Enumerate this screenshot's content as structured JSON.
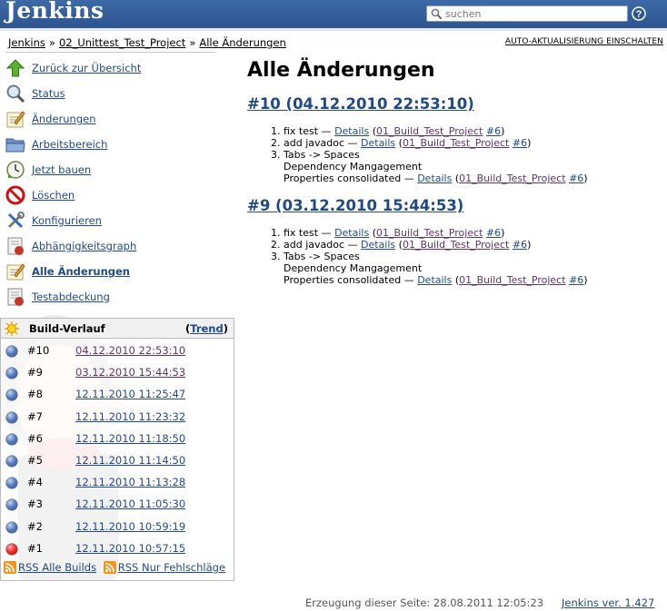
{
  "header": {
    "logo": "Jenkins",
    "search_placeholder": "suchen"
  },
  "breadcrumbs": [
    "Jenkins",
    "02_Unittest_Test_Project",
    "Alle Änderungen"
  ],
  "breadcrumb_separator": "»",
  "autorefresh": "AUTO-AKTUALISIERUNG EINSCHALTEN",
  "tasks": [
    {
      "label": "Zurück zur Übersicht",
      "icon": "up-arrow-icon"
    },
    {
      "label": "Status",
      "icon": "magnifier-icon"
    },
    {
      "label": "Änderungen",
      "icon": "notepad-icon"
    },
    {
      "label": "Arbeitsbereich",
      "icon": "folder-icon"
    },
    {
      "label": "Jetzt bauen",
      "icon": "clock-build-icon"
    },
    {
      "label": "Löschen",
      "icon": "no-entry-icon"
    },
    {
      "label": "Konfigurieren",
      "icon": "tools-icon"
    },
    {
      "label": "Abhängigkeitsgraph",
      "icon": "graph-icon"
    },
    {
      "label": "Alle Änderungen",
      "icon": "notepad-icon"
    },
    {
      "label": "Testabdeckung",
      "icon": "report-icon"
    }
  ],
  "build_history": {
    "title": "Build-Verlauf",
    "trend_label": "Trend",
    "builds": [
      {
        "number": "#10",
        "date": "04.12.2010 22:53:10",
        "status": "blue"
      },
      {
        "number": "#9",
        "date": "03.12.2010 15:44:53",
        "status": "blue"
      },
      {
        "number": "#8",
        "date": "12.11.2010 11:25:47",
        "status": "blue"
      },
      {
        "number": "#7",
        "date": "12.11.2010 11:23:32",
        "status": "blue"
      },
      {
        "number": "#6",
        "date": "12.11.2010 11:18:50",
        "status": "blue"
      },
      {
        "number": "#5",
        "date": "12.11.2010 11:14:50",
        "status": "blue"
      },
      {
        "number": "#4",
        "date": "12.11.2010 11:13:28",
        "status": "blue"
      },
      {
        "number": "#3",
        "date": "12.11.2010 11:05:30",
        "status": "blue"
      },
      {
        "number": "#2",
        "date": "12.11.2010 10:59:19",
        "status": "blue"
      },
      {
        "number": "#1",
        "date": "12.11.2010 10:57:15",
        "status": "red"
      }
    ],
    "rss_all": "RSS Alle Builds",
    "rss_failed": "RSS Nur Fehlschläge"
  },
  "main": {
    "title": "Alle Änderungen",
    "builds": [
      {
        "heading": "#10 (04.12.2010 22:53:10)",
        "changes": [
          {
            "lines": [
              "fix test"
            ],
            "details": "Details",
            "project": "01_Build_Test_Project",
            "ref": "#6"
          },
          {
            "lines": [
              "add javadoc"
            ],
            "details": "Details",
            "project": "01_Build_Test_Project",
            "ref": "#6"
          },
          {
            "lines": [
              "Tabs -> Spaces",
              "Dependency Mangagement",
              "Properties consolidated"
            ],
            "details": "Details",
            "project": "01_Build_Test_Project",
            "ref": "#6"
          }
        ]
      },
      {
        "heading": "#9 (03.12.2010 15:44:53)",
        "changes": [
          {
            "lines": [
              "fix test"
            ],
            "details": "Details",
            "project": "01_Build_Test_Project",
            "ref": "#6"
          },
          {
            "lines": [
              "add javadoc"
            ],
            "details": "Details",
            "project": "01_Build_Test_Project",
            "ref": "#6"
          },
          {
            "lines": [
              "Tabs -> Spaces",
              "Dependency Mangagement",
              "Properties consolidated"
            ],
            "details": "Details",
            "project": "01_Build_Test_Project",
            "ref": "#6"
          }
        ]
      }
    ],
    "dash": "—"
  },
  "footer": {
    "generated": "Erzeugung dieser Seite: 28.08.2011 12:05:23",
    "version": "Jenkins ver. 1.427"
  },
  "colors": {
    "header": "#3465a4",
    "link": "#204a87",
    "visited_link": "#5c3566",
    "stable": "#3b5fa0",
    "failed": "#dd2222"
  }
}
